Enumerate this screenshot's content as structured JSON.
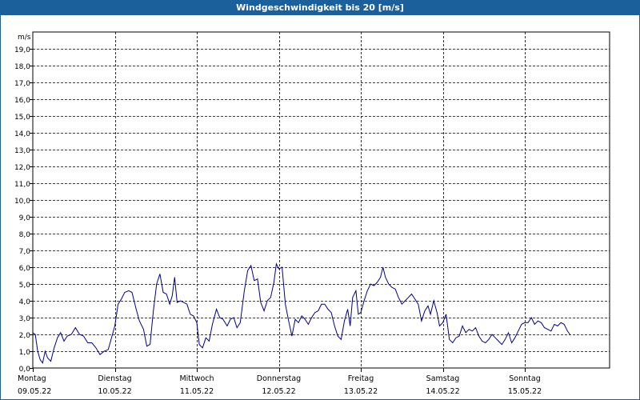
{
  "window": {
    "title": "Windgeschwindigkeit bis 20 [m/s]"
  },
  "chart_data": {
    "type": "line",
    "title": "Windgeschwindigkeit bis 20 [m/s]",
    "ylabel": "m/s",
    "ylim": [
      0,
      20
    ],
    "grid": true,
    "line_color": "#00008b",
    "yticks": [
      "0,0",
      "1,0",
      "2,0",
      "3,0",
      "4,0",
      "5,0",
      "6,0",
      "7,0",
      "8,0",
      "9,0",
      "10,0",
      "11,0",
      "12,0",
      "13,0",
      "14,0",
      "15,0",
      "16,0",
      "17,0",
      "18,0",
      "19,0"
    ],
    "days": [
      {
        "name": "Montag",
        "date": "09.05.22"
      },
      {
        "name": "Dienstag",
        "date": "10.05.22"
      },
      {
        "name": "Mittwoch",
        "date": "11.05.22"
      },
      {
        "name": "Donnerstag",
        "date": "12.05.22"
      },
      {
        "name": "Freitag",
        "date": "13.05.22"
      },
      {
        "name": "Samstag",
        "date": "14.05.22"
      },
      {
        "name": "Sonntag",
        "date": "15.05.22"
      }
    ],
    "series": [
      {
        "x_unit": "days since 09.05.22 00:00",
        "points": [
          [
            0.0,
            2.1
          ],
          [
            0.03,
            2.0
          ],
          [
            0.06,
            1.0
          ],
          [
            0.09,
            0.5
          ],
          [
            0.12,
            0.3
          ],
          [
            0.15,
            1.0
          ],
          [
            0.18,
            0.6
          ],
          [
            0.22,
            0.4
          ],
          [
            0.26,
            1.2
          ],
          [
            0.3,
            1.8
          ],
          [
            0.34,
            2.1
          ],
          [
            0.38,
            1.6
          ],
          [
            0.42,
            1.9
          ],
          [
            0.47,
            2.0
          ],
          [
            0.52,
            2.4
          ],
          [
            0.57,
            2.0
          ],
          [
            0.62,
            1.9
          ],
          [
            0.67,
            1.5
          ],
          [
            0.72,
            1.5
          ],
          [
            0.77,
            1.2
          ],
          [
            0.82,
            0.8
          ],
          [
            0.87,
            1.0
          ],
          [
            0.92,
            1.1
          ],
          [
            0.96,
            1.8
          ],
          [
            1.0,
            2.5
          ],
          [
            1.04,
            3.8
          ],
          [
            1.08,
            4.1
          ],
          [
            1.12,
            4.5
          ],
          [
            1.17,
            4.6
          ],
          [
            1.21,
            4.5
          ],
          [
            1.26,
            3.5
          ],
          [
            1.3,
            2.8
          ],
          [
            1.35,
            2.3
          ],
          [
            1.39,
            1.3
          ],
          [
            1.43,
            1.4
          ],
          [
            1.47,
            3.4
          ],
          [
            1.51,
            5.0
          ],
          [
            1.55,
            5.6
          ],
          [
            1.59,
            4.5
          ],
          [
            1.63,
            4.4
          ],
          [
            1.67,
            3.8
          ],
          [
            1.7,
            4.3
          ],
          [
            1.73,
            5.4
          ],
          [
            1.76,
            3.9
          ],
          [
            1.8,
            4.0
          ],
          [
            1.84,
            3.9
          ],
          [
            1.88,
            3.8
          ],
          [
            1.92,
            3.2
          ],
          [
            1.96,
            3.1
          ],
          [
            2.0,
            2.7
          ],
          [
            2.03,
            1.4
          ],
          [
            2.07,
            1.2
          ],
          [
            2.11,
            1.8
          ],
          [
            2.15,
            1.6
          ],
          [
            2.19,
            2.6
          ],
          [
            2.24,
            3.5
          ],
          [
            2.28,
            3.0
          ],
          [
            2.32,
            2.9
          ],
          [
            2.37,
            2.5
          ],
          [
            2.41,
            2.9
          ],
          [
            2.45,
            3.0
          ],
          [
            2.49,
            2.4
          ],
          [
            2.53,
            2.7
          ],
          [
            2.58,
            4.6
          ],
          [
            2.62,
            5.8
          ],
          [
            2.66,
            6.1
          ],
          [
            2.7,
            5.2
          ],
          [
            2.74,
            5.3
          ],
          [
            2.78,
            3.9
          ],
          [
            2.82,
            3.4
          ],
          [
            2.86,
            4.0
          ],
          [
            2.9,
            4.2
          ],
          [
            2.94,
            5.1
          ],
          [
            2.97,
            6.2
          ],
          [
            3.0,
            5.9
          ],
          [
            3.04,
            6.0
          ],
          [
            3.08,
            3.8
          ],
          [
            3.12,
            2.8
          ],
          [
            3.16,
            1.9
          ],
          [
            3.2,
            2.9
          ],
          [
            3.24,
            2.7
          ],
          [
            3.28,
            3.1
          ],
          [
            3.32,
            2.9
          ],
          [
            3.36,
            2.6
          ],
          [
            3.4,
            3.0
          ],
          [
            3.44,
            3.3
          ],
          [
            3.48,
            3.4
          ],
          [
            3.52,
            3.8
          ],
          [
            3.56,
            3.8
          ],
          [
            3.6,
            3.5
          ],
          [
            3.64,
            3.3
          ],
          [
            3.68,
            2.5
          ],
          [
            3.72,
            1.9
          ],
          [
            3.76,
            1.7
          ],
          [
            3.8,
            2.8
          ],
          [
            3.84,
            3.5
          ],
          [
            3.87,
            2.5
          ],
          [
            3.9,
            4.2
          ],
          [
            3.94,
            4.6
          ],
          [
            3.97,
            3.2
          ],
          [
            4.0,
            3.3
          ],
          [
            4.04,
            4.0
          ],
          [
            4.08,
            4.6
          ],
          [
            4.12,
            5.0
          ],
          [
            4.16,
            4.9
          ],
          [
            4.2,
            5.1
          ],
          [
            4.24,
            5.4
          ],
          [
            4.27,
            6.0
          ],
          [
            4.3,
            5.4
          ],
          [
            4.34,
            5.0
          ],
          [
            4.38,
            4.8
          ],
          [
            4.42,
            4.7
          ],
          [
            4.46,
            4.2
          ],
          [
            4.5,
            3.8
          ],
          [
            4.54,
            4.0
          ],
          [
            4.58,
            4.2
          ],
          [
            4.62,
            4.4
          ],
          [
            4.66,
            4.1
          ],
          [
            4.7,
            3.8
          ],
          [
            4.74,
            2.8
          ],
          [
            4.78,
            3.4
          ],
          [
            4.82,
            3.7
          ],
          [
            4.85,
            3.2
          ],
          [
            4.89,
            4.0
          ],
          [
            4.93,
            3.3
          ],
          [
            4.96,
            2.5
          ],
          [
            5.0,
            2.7
          ],
          [
            5.04,
            3.2
          ],
          [
            5.08,
            1.7
          ],
          [
            5.12,
            1.5
          ],
          [
            5.16,
            1.8
          ],
          [
            5.2,
            1.9
          ],
          [
            5.24,
            2.5
          ],
          [
            5.28,
            2.1
          ],
          [
            5.32,
            2.3
          ],
          [
            5.36,
            2.2
          ],
          [
            5.4,
            2.4
          ],
          [
            5.44,
            1.9
          ],
          [
            5.48,
            1.6
          ],
          [
            5.52,
            1.5
          ],
          [
            5.56,
            1.7
          ],
          [
            5.6,
            2.0
          ],
          [
            5.64,
            1.8
          ],
          [
            5.68,
            1.6
          ],
          [
            5.72,
            1.4
          ],
          [
            5.76,
            1.7
          ],
          [
            5.8,
            2.1
          ],
          [
            5.84,
            1.5
          ],
          [
            5.88,
            1.8
          ],
          [
            5.92,
            2.2
          ],
          [
            5.96,
            2.6
          ],
          [
            6.0,
            2.7
          ],
          [
            6.04,
            2.7
          ],
          [
            6.08,
            3.0
          ],
          [
            6.12,
            2.6
          ],
          [
            6.16,
            2.8
          ],
          [
            6.2,
            2.7
          ],
          [
            6.24,
            2.4
          ],
          [
            6.28,
            2.3
          ],
          [
            6.32,
            2.2
          ],
          [
            6.36,
            2.6
          ],
          [
            6.4,
            2.5
          ],
          [
            6.44,
            2.7
          ],
          [
            6.48,
            2.6
          ],
          [
            6.52,
            2.2
          ],
          [
            6.55,
            2.0
          ]
        ]
      }
    ]
  }
}
